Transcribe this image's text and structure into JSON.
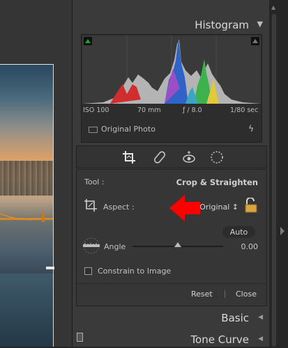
{
  "panel": {
    "histogram": {
      "title": "Histogram",
      "iso": "ISO 100",
      "focal": "70 mm",
      "aperture": "ƒ / 8.0",
      "shutter": "1/80 sec",
      "original_label": "Original Photo"
    },
    "crop": {
      "tool_label": "Tool :",
      "tool_name": "Crop & Straighten",
      "aspect_label": "Aspect :",
      "aspect_value": "Original ↕",
      "auto_label": "Auto",
      "angle_label": "Angle",
      "angle_value": "0.00",
      "angle_fraction": 0.5,
      "constrain_label": "Constrain to Image",
      "constrain_checked": false,
      "reset_label": "Reset",
      "close_label": "Close"
    },
    "basic": {
      "title": "Basic"
    },
    "tone_curve": {
      "title": "Tone Curve"
    }
  },
  "colors": {
    "accent_red": "#ff0000",
    "panel_bg": "#3a3a3a",
    "clip_indicator": "#1fa035"
  }
}
